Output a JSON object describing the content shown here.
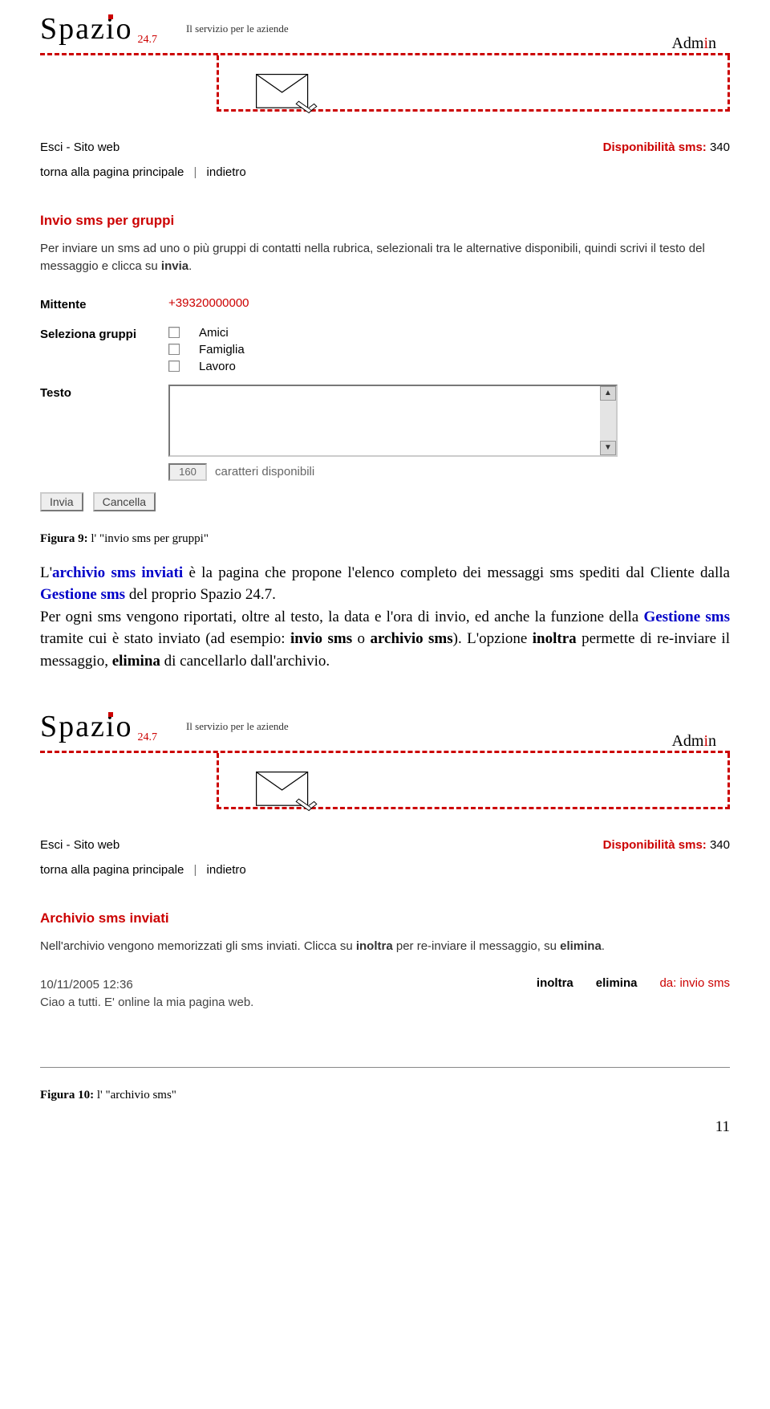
{
  "logo": {
    "main": "Spaz",
    "i": "i",
    "o": "o",
    "sub": "24.7",
    "tagline": "Il servizio per le aziende"
  },
  "admin_label": {
    "pre": "Adm",
    "i": "i",
    "post": "n"
  },
  "topnav": {
    "esci": "Esci",
    "dash1": " - ",
    "sito": "Sito web",
    "dispon_label": "Disponibilità sms:",
    "dispon_val": "340"
  },
  "breadcrumb": {
    "home": "torna alla pagina principale",
    "sep": "|",
    "back": "indietro"
  },
  "panel1": {
    "title": "Invio sms per gruppi",
    "desc_1": "Per inviare un sms ad uno o più gruppi di contatti nella rubrica, selezionali tra le alternative disponibili, quindi scrivi il testo del messaggio e clicca su ",
    "desc_bold": "invia",
    "desc_2": ".",
    "mittente_label": "Mittente",
    "mittente_value": "+39320000000",
    "gruppi_label": "Seleziona gruppi",
    "groups": [
      "Amici",
      "Famiglia",
      "Lavoro"
    ],
    "testo_label": "Testo",
    "counter_value": "160",
    "counter_label": "caratteri disponibili",
    "btn_invia": "Invia",
    "btn_cancella": "Cancella"
  },
  "caption1": {
    "b": "Figura  9:",
    "rest": " l' \"invio sms per gruppi\""
  },
  "doc": {
    "t1": "L'",
    "blue1": "archivio sms inviati",
    "t2": " è la pagina che propone l'elenco completo dei messaggi sms spediti dal Cliente dalla ",
    "blue2": "Gestione sms",
    "t3": " del proprio Spazio 24.7.",
    "t4": "Per ogni sms vengono riportati, oltre al testo, la data e l'ora di invio, ed anche la funzione della ",
    "blue3": "Gestione sms",
    "t5": " tramite cui è stato inviato (ad esempio: ",
    "b1": "invio sms",
    "t6": " o ",
    "b2": "archivio sms",
    "t7": "). L'opzione ",
    "b3": "inoltra",
    "t8": " permette di re-inviare il messaggio, ",
    "b4": "elimina",
    "t9": " di cancellarlo dall'archivio."
  },
  "panel2": {
    "title": "Archivio sms inviati",
    "desc_1": "Nell'archivio  vengono memorizzati gli sms inviati. Clicca su ",
    "desc_b1": "inoltra",
    "desc_2": " per re-inviare il messaggio, su ",
    "desc_b2": "elimina",
    "desc_3": ".",
    "entry": {
      "date": "10/11/2005  12:36",
      "text": "Ciao a tutti. E' online la mia pagina web.",
      "inoltra": "inoltra",
      "elimina": "elimina",
      "from": "da: invio sms"
    }
  },
  "caption2": {
    "b": "Figura  10:",
    "rest": " l' \"archivio sms\""
  },
  "page_number": "11"
}
